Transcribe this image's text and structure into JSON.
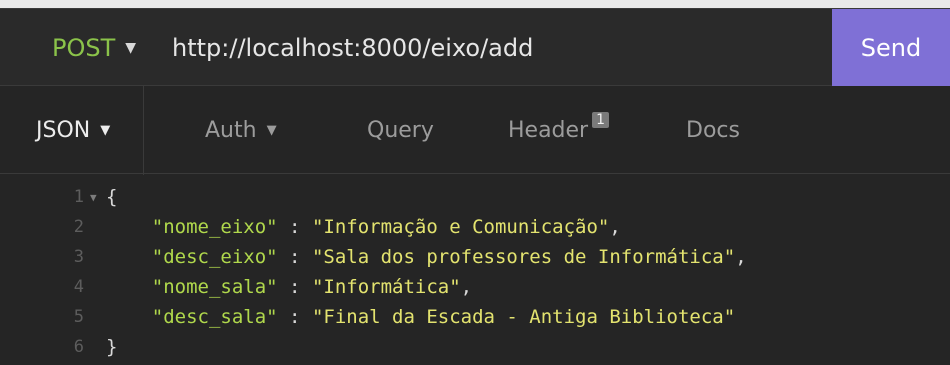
{
  "request": {
    "method": "POST",
    "url": "http://localhost:8000/eixo/add",
    "send_label": "Send"
  },
  "tabs": [
    {
      "label": "JSON",
      "active": true,
      "dropdown": true
    },
    {
      "label": "Auth",
      "active": false,
      "dropdown": true
    },
    {
      "label": "Query",
      "active": false
    },
    {
      "label": "Header",
      "active": false,
      "badge": "1"
    },
    {
      "label": "Docs",
      "active": false
    }
  ],
  "editor": {
    "line_numbers": [
      "1",
      "2",
      "3",
      "4",
      "5",
      "6"
    ],
    "open_brace": "{",
    "close_brace": "}",
    "fields": [
      {
        "key": "\"nome_eixo\"",
        "value": "\"Informação e Comunicação\"",
        "trailing": ","
      },
      {
        "key": "\"desc_eixo\"",
        "value": "\"Sala dos professores de Informática\"",
        "trailing": ","
      },
      {
        "key": "\"nome_sala\"",
        "value": "\"Informática\"",
        "trailing": ","
      },
      {
        "key": "\"desc_sala\"",
        "value": "\"Final da Escada - Antiga Biblioteca\"",
        "trailing": ""
      }
    ]
  },
  "colors": {
    "method": "#8bc34a",
    "send_bg": "#7f70d6",
    "json_key": "#b0d84c",
    "json_string": "#e3e36f"
  }
}
